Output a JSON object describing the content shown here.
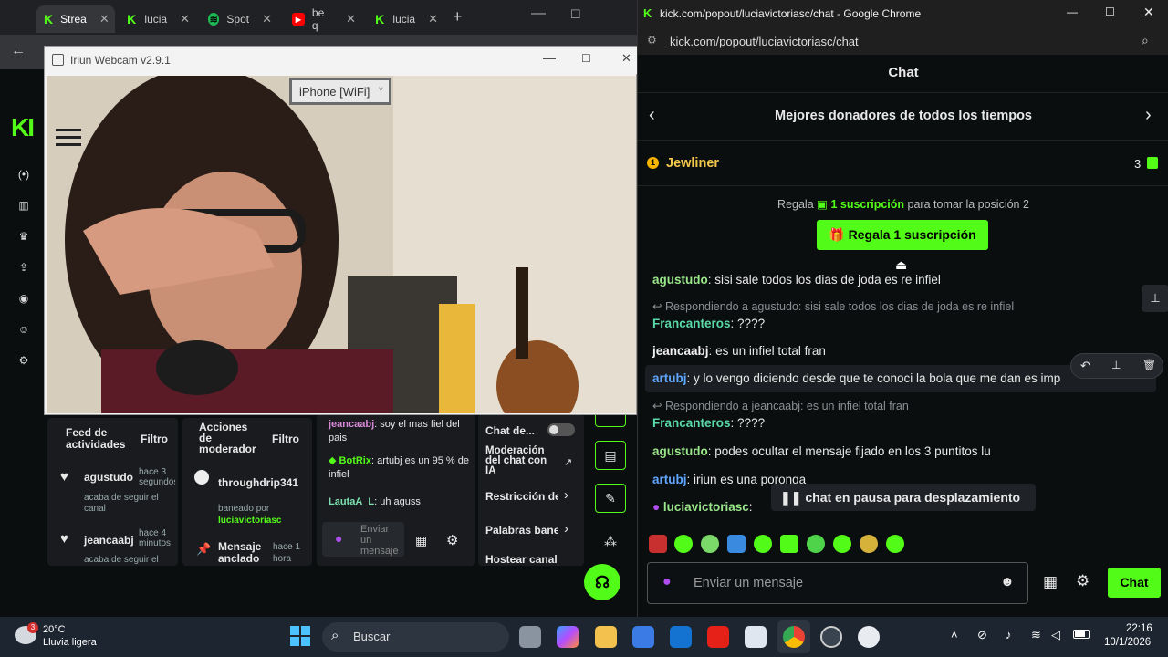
{
  "left_browser": {
    "tabs": [
      {
        "label": "Strea",
        "icon": "kick-icon"
      },
      {
        "label": "lucia",
        "icon": "kick-icon"
      },
      {
        "label": "Spot",
        "icon": "spotify-icon"
      },
      {
        "label": "be q",
        "icon": "youtube-icon"
      },
      {
        "label": "lucia",
        "icon": "kick-icon"
      }
    ],
    "new_tab": "+"
  },
  "iriun": {
    "title": "Iriun Webcam v2.9.1",
    "device": "iPhone [WiFi]"
  },
  "activity_feed": {
    "title": "Feed de actividades",
    "filter": "Filtro",
    "items": [
      {
        "user": "agustudo",
        "time": "hace 3 segundos",
        "text": "acaba de seguir el canal"
      },
      {
        "user": "jeancaabj",
        "time": "hace 4 minutos",
        "text": "acaba de seguir el"
      }
    ]
  },
  "mod_actions": {
    "title": "Acciones de moderador",
    "filter": "Filtro",
    "items": [
      {
        "user": "throughdrip341",
        "text": "baneado por",
        "by": "luciavictoriasc"
      },
      {
        "user": "Mensaje anclado",
        "time": "hace 1 hora"
      }
    ]
  },
  "mini_chat": {
    "messages": [
      {
        "user": "jeancaabj",
        "text": " soy el mas fiel del pais"
      },
      {
        "user": "BotRix",
        "text": " artubj es un 95 % de infiel"
      },
      {
        "user": "LautaA_L",
        "text": " uh aguss"
      }
    ],
    "input_placeholder": "Enviar un mensaje"
  },
  "settings_panel": {
    "items": [
      "Chat de...",
      "Moderación del chat con IA",
      "Restricción de",
      "Palabras bane",
      "Hostear canal"
    ]
  },
  "right_window": {
    "title": "kick.com/popout/luciavictoriasc/chat - Google Chrome",
    "url": "kick.com/popout/luciavictoriasc/chat",
    "chat_header": "Chat",
    "top_donors_title": "Mejores donadores de todos los tiempos",
    "donor": {
      "rank": "1",
      "name": "Jewliner",
      "count": "3"
    },
    "gift_prompt_pre": "Regala",
    "gift_prompt_highlight": "1 suscripción",
    "gift_prompt_post": "para tomar la posición 2",
    "gift_button": "Regala 1 suscripción",
    "messages": [
      {
        "user": "agustudo",
        "text": " sisi sale todos los dias de joda es re infiel"
      },
      {
        "reply": "Respondiendo a agustudo: sisi sale todos los dias de joda es re infiel"
      },
      {
        "user": "Francanteros",
        "text": " ????"
      },
      {
        "user": "jeancaabj",
        "text": " es un infiel total fran"
      },
      {
        "user": "artubj",
        "text": " y lo vengo diciendo desde que te conoci la bola que me dan es imp"
      },
      {
        "reply": "Respondiendo a jeancaabj: es un infiel total fran"
      },
      {
        "user": "Francanteros",
        "text": " ????"
      },
      {
        "user": "agustudo",
        "text": " podes ocultar el mensaje fijado en los 3 puntitos lu"
      },
      {
        "user": "artubj",
        "text": " iriun es una poronga"
      },
      {
        "user": "luciavictoriasc",
        "text": ""
      }
    ],
    "paused_text": "chat en pausa para desplazamiento",
    "input_placeholder": "Enviar un mensaje",
    "send_button": "Chat"
  },
  "taskbar": {
    "weather_temp": "20°C",
    "weather_desc": "Lluvia ligera",
    "weather_badge": "3",
    "search_label": "Buscar",
    "time": "22:16",
    "date": "10/1/2026"
  },
  "colors": {
    "kick_green": "#53fc18",
    "bg": "#0b0e0f"
  }
}
